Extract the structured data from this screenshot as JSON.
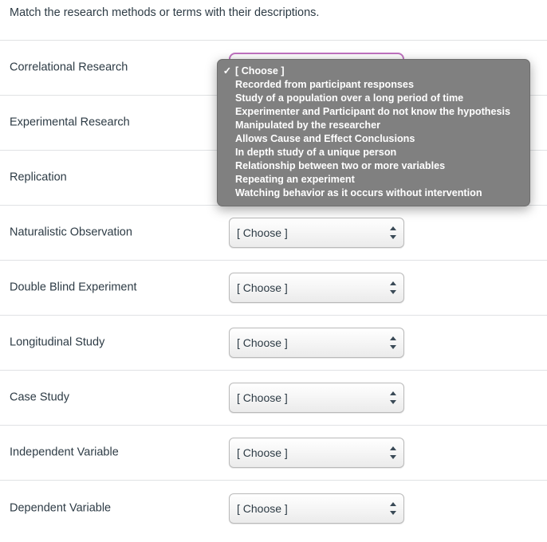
{
  "quiz": {
    "prompt": "Match the research methods or terms with their descriptions.",
    "select_placeholder": "[ Choose ]",
    "focus_ring_color": "#bf72bf",
    "menu_background_color": "#808080",
    "text_color": "#2d3b45"
  },
  "rows": [
    {
      "term": "Correlational Research",
      "value": "[ Choose ]",
      "open": true
    },
    {
      "term": "Experimental Research",
      "value": "[ Choose ]",
      "open": false
    },
    {
      "term": "Replication",
      "value": "[ Choose ]",
      "open": false
    },
    {
      "term": "Naturalistic Observation",
      "value": "[ Choose ]",
      "open": false
    },
    {
      "term": "Double Blind Experiment",
      "value": "[ Choose ]",
      "open": false
    },
    {
      "term": "Longitudinal Study",
      "value": "[ Choose ]",
      "open": false
    },
    {
      "term": "Case Study",
      "value": "[ Choose ]",
      "open": false
    },
    {
      "term": "Independent Variable",
      "value": "[ Choose ]",
      "open": false
    },
    {
      "term": "Dependent Variable",
      "value": "[ Choose ]",
      "open": false
    }
  ],
  "dropdown": {
    "selected_index": 0,
    "check_glyph": "✓",
    "options": [
      "[ Choose ]",
      "Recorded from participant responses",
      "Study of a population over a long period of time",
      "Experimenter and Participant do not know the hypothesis",
      "Manipulated by the researcher",
      "Allows Cause and Effect Conclusions",
      "In depth study of a unique person",
      "Relationship between two or more variables",
      "Repeating an experiment",
      "Watching behavior as it occurs without intervention"
    ]
  }
}
